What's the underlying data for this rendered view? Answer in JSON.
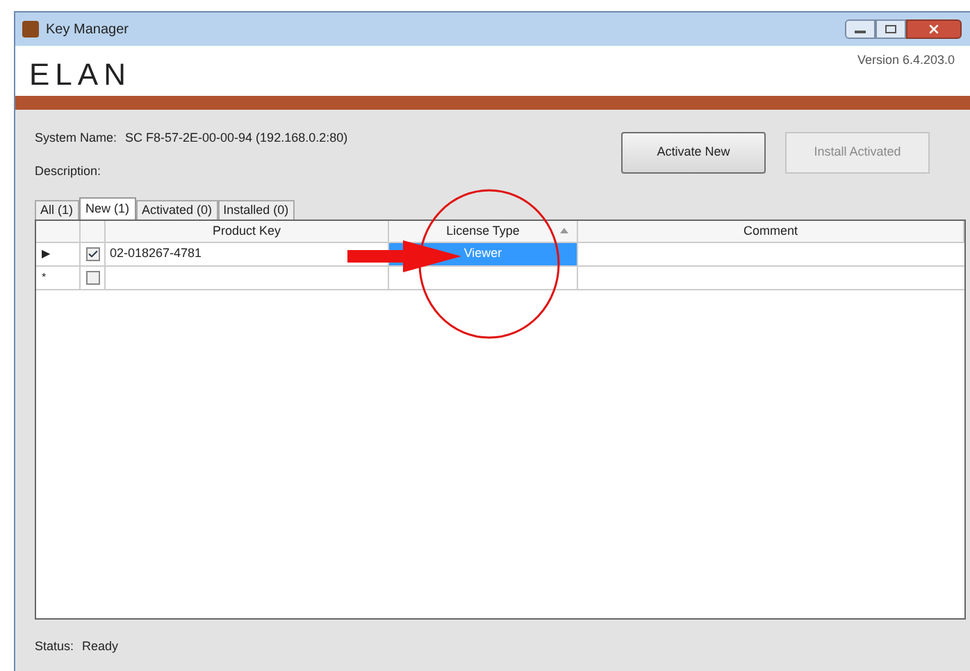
{
  "window": {
    "title": "Key Manager"
  },
  "header": {
    "logo": "ELAN",
    "version": "Version 6.4.203.0"
  },
  "system_name": {
    "label": "System Name:",
    "value": "SC F8-57-2E-00-00-94 (192.168.0.2:80)"
  },
  "description": {
    "label": "Description:"
  },
  "buttons": [
    {
      "label": "Activate New",
      "disabled": false
    },
    {
      "label": "Install Activated",
      "disabled": true
    }
  ],
  "tabs": [
    {
      "label": "All (1)",
      "selected": false
    },
    {
      "label": "New (1)",
      "selected": true
    },
    {
      "label": "Activated (0)",
      "selected": false
    },
    {
      "label": "Installed (0)",
      "selected": false
    }
  ],
  "table": {
    "columns": [
      {
        "label": "Product Key",
        "sorted": false
      },
      {
        "label": "License Type",
        "sorted": true
      },
      {
        "label": "Comment",
        "sorted": false
      }
    ],
    "rows": [
      {
        "marker": "▶",
        "checked": true,
        "product_key": "02-018267-4781",
        "license_type": "Viewer",
        "comment": "",
        "license_selected": true
      },
      {
        "marker": "*",
        "checked": false,
        "product_key": "",
        "license_type": "",
        "comment": "",
        "license_selected": false
      }
    ]
  },
  "status_bar": {
    "label": "Status:",
    "value": "Ready"
  }
}
